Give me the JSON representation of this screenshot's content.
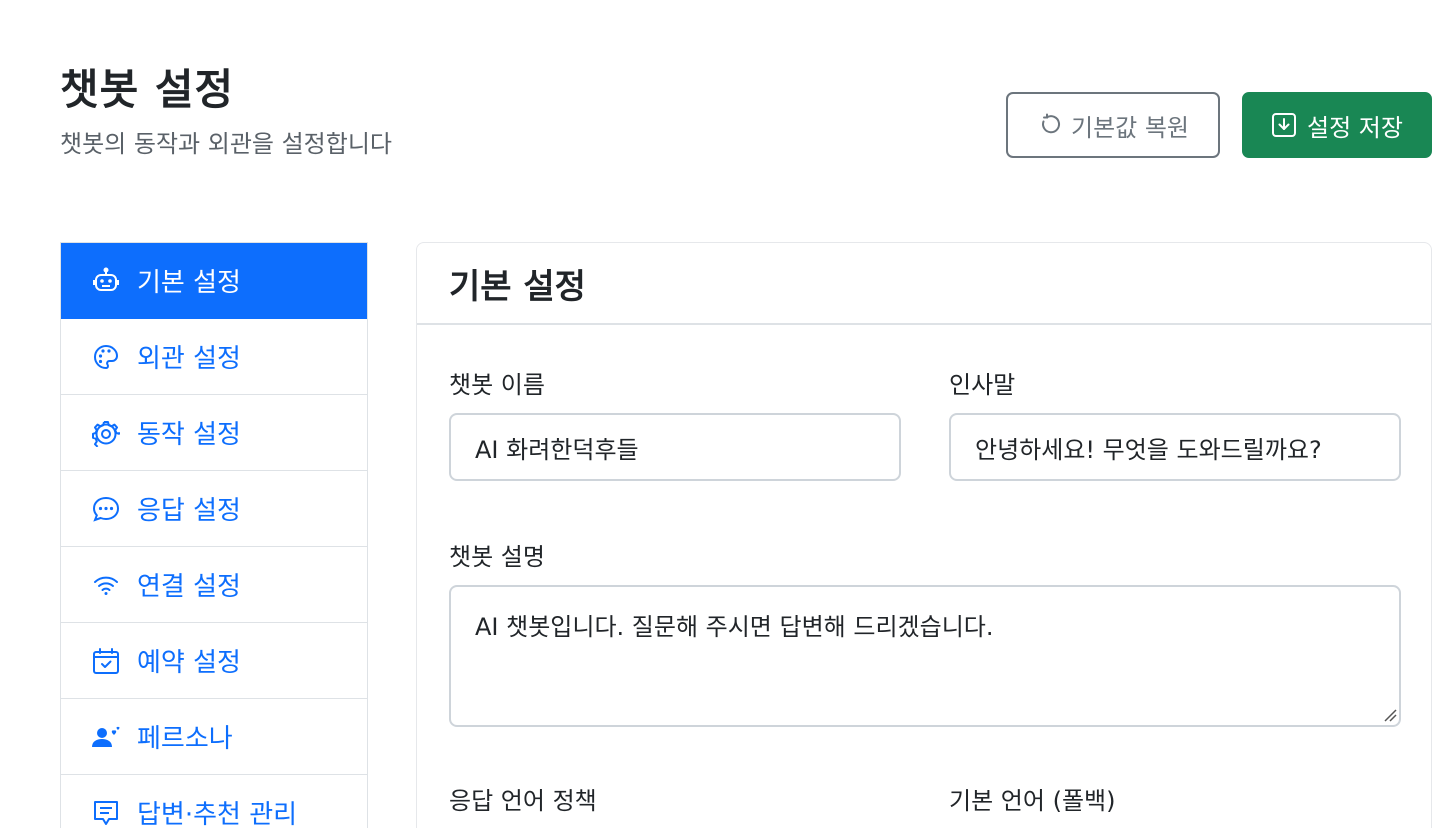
{
  "header": {
    "title": "챗봇 설정",
    "subtitle": "챗봇의 동작과 외관을 설정합니다",
    "reset_label": "기본값 복원",
    "save_label": "설정 저장"
  },
  "sidebar": {
    "items": [
      {
        "label": "기본 설정",
        "icon": "robot-icon",
        "active": true
      },
      {
        "label": "외관 설정",
        "icon": "palette-icon"
      },
      {
        "label": "동작 설정",
        "icon": "gear-icon"
      },
      {
        "label": "응답 설정",
        "icon": "chat-dots-icon"
      },
      {
        "label": "연결 설정",
        "icon": "wifi-icon"
      },
      {
        "label": "예약 설정",
        "icon": "calendar-check-icon"
      },
      {
        "label": "페르소나",
        "icon": "person-hearts-icon"
      },
      {
        "label": "답변·추천 관리",
        "icon": "chat-square-text-icon"
      }
    ]
  },
  "main": {
    "section_title": "기본 설정",
    "name_label": "챗봇 이름",
    "name_value": "AI 화려한덕후들",
    "greeting_label": "인사말",
    "greeting_value": "안녕하세요! 무엇을 도와드릴까요?",
    "description_label": "챗봇 설명",
    "description_value": "AI 챗봇입니다. 질문해 주시면 답변해 드리겠습니다.",
    "language_policy_label": "응답 언어 정책",
    "default_language_label": "기본 언어 (폴백)"
  },
  "colors": {
    "primary": "#0d6efd",
    "success": "#198754",
    "secondary": "#6c757d",
    "border": "#dee2e6"
  }
}
